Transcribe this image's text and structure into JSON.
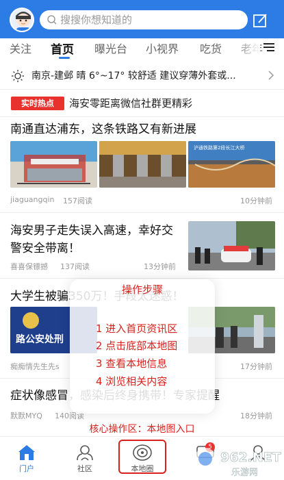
{
  "header": {
    "search_placeholder": "搜搜你想知道的"
  },
  "tabs": [
    {
      "label": "关注"
    },
    {
      "label": "首页"
    },
    {
      "label": "曝光台"
    },
    {
      "label": "小视界"
    },
    {
      "label": "吃货"
    },
    {
      "label": "老年"
    }
  ],
  "weather": {
    "text": "南京-建邺 晴 6°~17° 较舒适 建议穿薄外套或..."
  },
  "hot": {
    "badge": "实时热点",
    "text": "海安零距离微信社群更精彩"
  },
  "articles": [
    {
      "title": "南通直达浦东，这条铁路又有新进展",
      "author": "jiaguangqin",
      "reads": "157阅读",
      "time": "10分钟前"
    },
    {
      "title": "海安男子走失误入高速，幸好交警安全带离！",
      "author": "喜喜保镖撼",
      "reads": "137阅读",
      "time": "13分钟前"
    },
    {
      "title": "大学生被骗350万！手段太迷惑！",
      "author": "痴痴情先生先s",
      "reads": "",
      "time": "17分钟前"
    },
    {
      "title": "症状像感冒，感染后终身携带！专家提醒",
      "author": "默默MYQ",
      "reads": "140阅读",
      "time": "18分钟前"
    }
  ],
  "image_caption": "沪通铁路第2段长江大桥",
  "image_caption_police": "路公安处刑",
  "overlay": {
    "title": "操作步骤",
    "steps": [
      "1  进入首页资讯区",
      "2  点击底部本地图",
      "3  查看本地信息",
      "4  浏览相关内容"
    ],
    "core_label": "核心操作区：本地图入口"
  },
  "bottom_nav": [
    {
      "label": "门户",
      "icon": "home-icon"
    },
    {
      "label": "社区",
      "icon": "community-icon"
    },
    {
      "label": "本地圈",
      "icon": "local-circle-icon"
    },
    {
      "label": "",
      "icon": "message-icon"
    },
    {
      "label": "",
      "icon": "profile-icon"
    }
  ],
  "message_badge": "5",
  "watermark": {
    "brand": "962.NET",
    "sub": "乐游网"
  },
  "colors": {
    "brand_blue": "#2d7ce6",
    "accent_red": "#d9201b"
  }
}
